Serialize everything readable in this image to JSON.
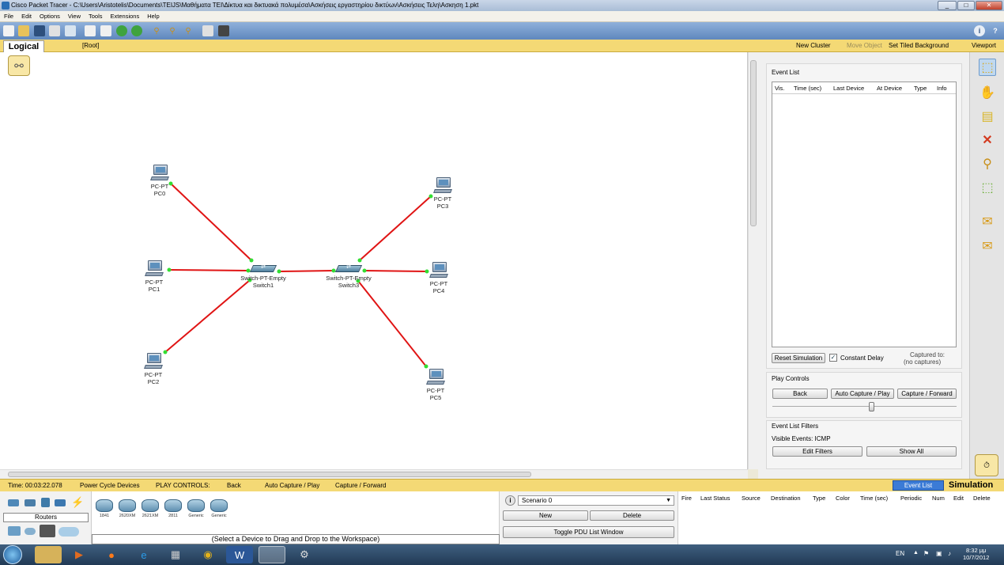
{
  "window": {
    "title": "Cisco Packet Tracer - C:\\Users\\Aristotelis\\Documents\\TEIJS\\Μαθήματα ΤΕΙ\\Δίκτυα και δικτυακά πολυμέσα\\Ασκήσεις εργαστηρίου δικτύων\\Ασκήσεις Τελη\\Ασκηση 1.pkt",
    "minimize": "_",
    "maximize": "□",
    "close": "✕"
  },
  "menu": [
    "File",
    "Edit",
    "Options",
    "View",
    "Tools",
    "Extensions",
    "Help"
  ],
  "toolbar": {
    "info": "i",
    "help": "?"
  },
  "workspace_bar": {
    "tab": "Logical",
    "root": "[Root]",
    "new_cluster": "New Cluster",
    "move_object": "Move Object",
    "set_tiled_background": "Set Tiled Background",
    "viewport": "Viewport"
  },
  "devices": {
    "pc0": {
      "type": "PC-PT",
      "name": "PC0"
    },
    "pc1": {
      "type": "PC-PT",
      "name": "PC1"
    },
    "pc2": {
      "type": "PC-PT",
      "name": "PC2"
    },
    "pc3": {
      "type": "PC-PT",
      "name": "PC3"
    },
    "pc4": {
      "type": "PC-PT",
      "name": "PC4"
    },
    "pc5": {
      "type": "PC-PT",
      "name": "PC5"
    },
    "switch1": {
      "type": "Switch-PT-Empty",
      "name": "Switch1"
    },
    "switch3": {
      "type": "Switch-PT-Empty",
      "name": "Switch3"
    }
  },
  "event_list": {
    "title": "Event List",
    "columns": [
      "Vis.",
      "Time (sec)",
      "Last Device",
      "At Device",
      "Type",
      "Info"
    ],
    "reset": "Reset Simulation",
    "constant_delay": "Constant Delay",
    "captured_to": "Captured to:",
    "no_captures": "(no captures)"
  },
  "play_controls": {
    "title": "Play Controls",
    "back": "Back",
    "auto_capture": "Auto Capture / Play",
    "capture_forward": "Capture / Forward"
  },
  "filters": {
    "title": "Event List Filters",
    "visible": "Visible Events: ICMP",
    "edit": "Edit Filters",
    "show_all": "Show All"
  },
  "status_bar": {
    "time": "Time: 00:03:22.078",
    "power_cycle": "Power Cycle Devices",
    "play_controls": "PLAY CONTROLS:",
    "back": "Back",
    "auto_capture": "Auto Capture / Play",
    "capture_forward": "Capture / Forward",
    "event_list": "Event List",
    "mode": "Simulation"
  },
  "device_panel": {
    "category": "Routers",
    "models": [
      "1841",
      "2620XM",
      "2621XM",
      "2811",
      "Generic",
      "Generic"
    ],
    "hint": "(Select a Device to Drag and Drop to the Workspace)"
  },
  "scenario": {
    "selected": "Scenario 0",
    "new": "New",
    "delete": "Delete",
    "toggle": "Toggle PDU List Window"
  },
  "pdu_columns": [
    "Fire",
    "Last Status",
    "Source",
    "Destination",
    "Type",
    "Color",
    "Time (sec)",
    "Periodic",
    "Num",
    "Edit",
    "Delete"
  ],
  "taskbar": {
    "lang": "EN",
    "time": "8:32 μμ",
    "date": "10/7/2012"
  },
  "colors": {
    "link": "#e01414",
    "port": "#33dd33",
    "yellow_bar": "#f4d975"
  }
}
